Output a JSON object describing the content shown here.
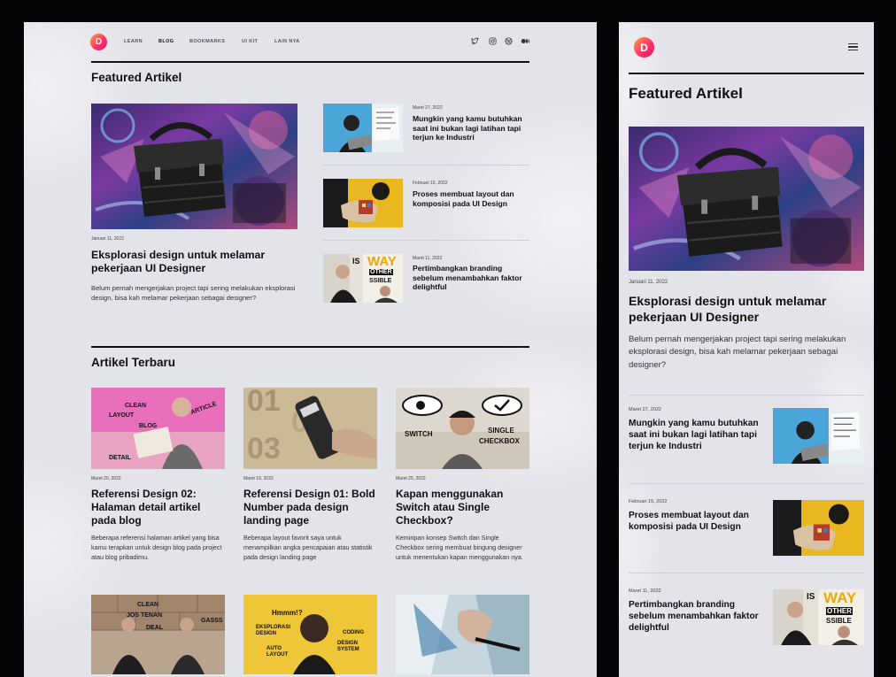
{
  "brand": {
    "logo_letter": "D",
    "accent": "#ff2d6f"
  },
  "nav": {
    "items": [
      "LEARN",
      "BLOG",
      "BOOKMARKS",
      "UI KIT",
      "LAIN NYA"
    ],
    "active": "BLOG"
  },
  "social_icons": [
    "twitter-icon",
    "instagram-icon",
    "dribbble-icon",
    "medium-icon"
  ],
  "featured": {
    "heading": "Featured Artikel",
    "main": {
      "date": "Januari 11, 2022",
      "title": "Eksplorasi design untuk melamar pekerjaan UI Designer",
      "desc": "Belum pernah mengerjakan project tapi sering melakukan eksplorasi design, bisa kah melamar pekerjaan sebagai designer?"
    },
    "side": [
      {
        "date": "Maret 27, 2022",
        "title": "Mungkin yang kamu butuhkan saat ini bukan lagi latihan tapi terjun ke Industri"
      },
      {
        "date": "Februari 15, 2022",
        "title": "Proses membuat layout dan komposisi pada UI Design"
      },
      {
        "date": "Maret 11, 2022",
        "title": "Pertimbangkan branding sebelum menambahkan faktor delightful"
      }
    ]
  },
  "recent": {
    "heading": "Artikel Terbaru",
    "items": [
      {
        "date": "Maret 20, 2022",
        "title": "Referensi Design 02: Halaman detail artikel pada blog",
        "desc": "Beberapa referensi halaman artikel yang bisa kamu terapkan untuk design blog pada project atau blog pribadimu."
      },
      {
        "date": "Maret 19, 2022",
        "title": "Referensi Design 01: Bold Number pada design landing page",
        "desc": "Beberapa layout favorit saya untuk menampilkan angka pencapaian atau statistik pada design landing page"
      },
      {
        "date": "Maret 25, 2022",
        "title": "Kapan menggunakan Switch atau Single Checkbox?",
        "desc": "Kemiripan konsep Switch dan Single Checkbox sering membuat bingung designer untuk menentukan kapan menggunakan nya."
      }
    ]
  },
  "mobile": {
    "heading": "Featured Artikel",
    "main": {
      "date": "Januari 11, 2022",
      "title": "Eksplorasi design untuk melamar pekerjaan UI Designer",
      "desc": "Belum pernah mengerjakan project tapi sering melakukan eksplorasi design, bisa kah melamar pekerjaan sebagai designer?"
    },
    "side": [
      {
        "date": "Maret 27, 2022",
        "title": "Mungkin yang kamu butuhkan saat ini bukan lagi latihan tapi terjun ke Industri"
      },
      {
        "date": "Februari 15, 2022",
        "title": "Proses membuat layout dan komposisi pada UI Design"
      },
      {
        "date": "Maret 11, 2022",
        "title": "Pertimbangkan branding sebelum menambahkan faktor delightful"
      }
    ]
  },
  "image_text": {
    "recent1": [
      "CLEAN",
      "LAYOUT",
      "BLOG",
      "ARTICLE",
      "DETAIL"
    ],
    "recent2": [
      "01",
      "02",
      "03"
    ],
    "recent3": [
      "SWITCH",
      "SINGLE",
      "CHECKBOX"
    ],
    "bottom1": [
      "CLEAN",
      "JOS TENAN",
      "GASSS",
      "DEAL"
    ],
    "bottom2": [
      "Hmmm!?",
      "EKSPLORASI DESIGN",
      "CODING",
      "DESIGN SYSTEM",
      "AUTO LAYOUT"
    ],
    "side3_sign": [
      "IS",
      "WAY",
      "OTHER",
      "SSIBLE"
    ]
  }
}
